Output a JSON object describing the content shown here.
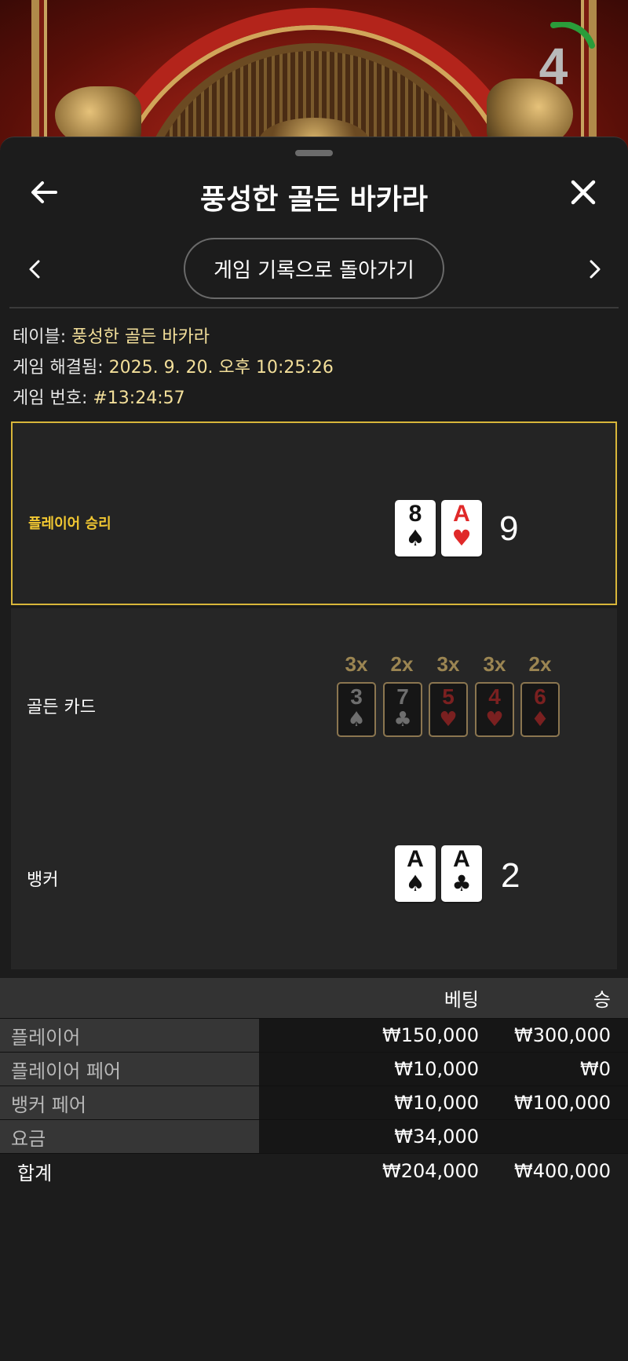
{
  "timer": {
    "value": "4",
    "progress": 0.2
  },
  "header": {
    "title": "풍성한 골든 바카라"
  },
  "nav": {
    "back_to_history": "게임 기록으로 돌아가기"
  },
  "info": {
    "table_label": "테이블:",
    "table_value": "풍성한 골든 바카라",
    "resolved_label": "게임 해결됨:",
    "resolved_value": "2025. 9. 20. 오후 10:25:26",
    "game_no_label": "게임 번호:",
    "game_no_value": "#13:24:57"
  },
  "player": {
    "label": "플레이어 승리",
    "cards": [
      {
        "rank": "8",
        "suit": "♠",
        "color": "black"
      },
      {
        "rank": "A",
        "suit": "♥",
        "color": "red"
      }
    ],
    "score": "9"
  },
  "golden": {
    "label": "골든 카드",
    "cards": [
      {
        "mult": "3x",
        "rank": "3",
        "suit": "♠",
        "color": "black"
      },
      {
        "mult": "2x",
        "rank": "7",
        "suit": "♣",
        "color": "black"
      },
      {
        "mult": "3x",
        "rank": "5",
        "suit": "♥",
        "color": "red"
      },
      {
        "mult": "3x",
        "rank": "4",
        "suit": "♥",
        "color": "red"
      },
      {
        "mult": "2x",
        "rank": "6",
        "suit": "♦",
        "color": "red"
      }
    ]
  },
  "banker": {
    "label": "뱅커",
    "cards": [
      {
        "rank": "A",
        "suit": "♠",
        "color": "black"
      },
      {
        "rank": "A",
        "suit": "♣",
        "color": "black"
      }
    ],
    "score": "2"
  },
  "bets": {
    "head": {
      "bet": "베팅",
      "win": "승"
    },
    "rows": [
      {
        "name": "플레이어",
        "bet": "₩150,000",
        "win": "₩300,000"
      },
      {
        "name": "플레이어 페어",
        "bet": "₩10,000",
        "win": "₩0"
      },
      {
        "name": "뱅커 페어",
        "bet": "₩10,000",
        "win": "₩100,000"
      },
      {
        "name": "요금",
        "bet": "₩34,000",
        "win": ""
      }
    ],
    "total": {
      "name": "합계",
      "bet": "₩204,000",
      "win": "₩400,000"
    }
  },
  "icons": [
    "back-arrow-icon",
    "close-icon",
    "chevron-left-icon",
    "chevron-right-icon"
  ],
  "colors": {
    "accent_gold": "#d8b63a",
    "player_win_text": "#f2c832",
    "info_value": "#f3df9a",
    "timer_arc": "#2a9d3a"
  }
}
